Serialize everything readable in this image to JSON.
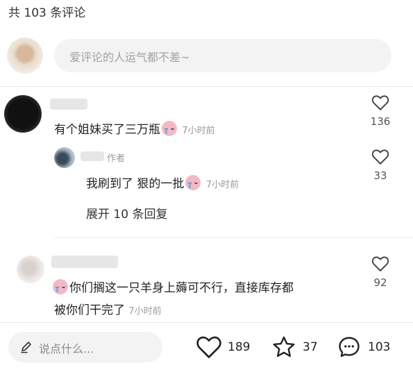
{
  "header": {
    "title": "共 103 条评论"
  },
  "composer": {
    "placeholder": "爱评论的人运气都不差~"
  },
  "comments": [
    {
      "text": "有个姐妹买了三万瓶",
      "time": "7小时前",
      "likes": "136"
    },
    {
      "reply_text": "我刷到了 狠的一批",
      "author_tag": "作者",
      "time": "7小时前",
      "likes": "33"
    },
    {
      "text_line1": "你们搁这一只羊身上薅可不行，直接库存都",
      "text_line2": "被你们干完了",
      "time": "7小时前",
      "likes": "92"
    }
  ],
  "thread": {
    "expand_label": "展开 10 条回复"
  },
  "bottom_bar": {
    "placeholder": "说点什么...",
    "like_count": "189",
    "star_count": "37",
    "comment_count": "103"
  },
  "icons": [
    "heart-icon",
    "star-icon",
    "comment-bubble-icon",
    "pencil-icon",
    "crying-emoji-icon"
  ]
}
